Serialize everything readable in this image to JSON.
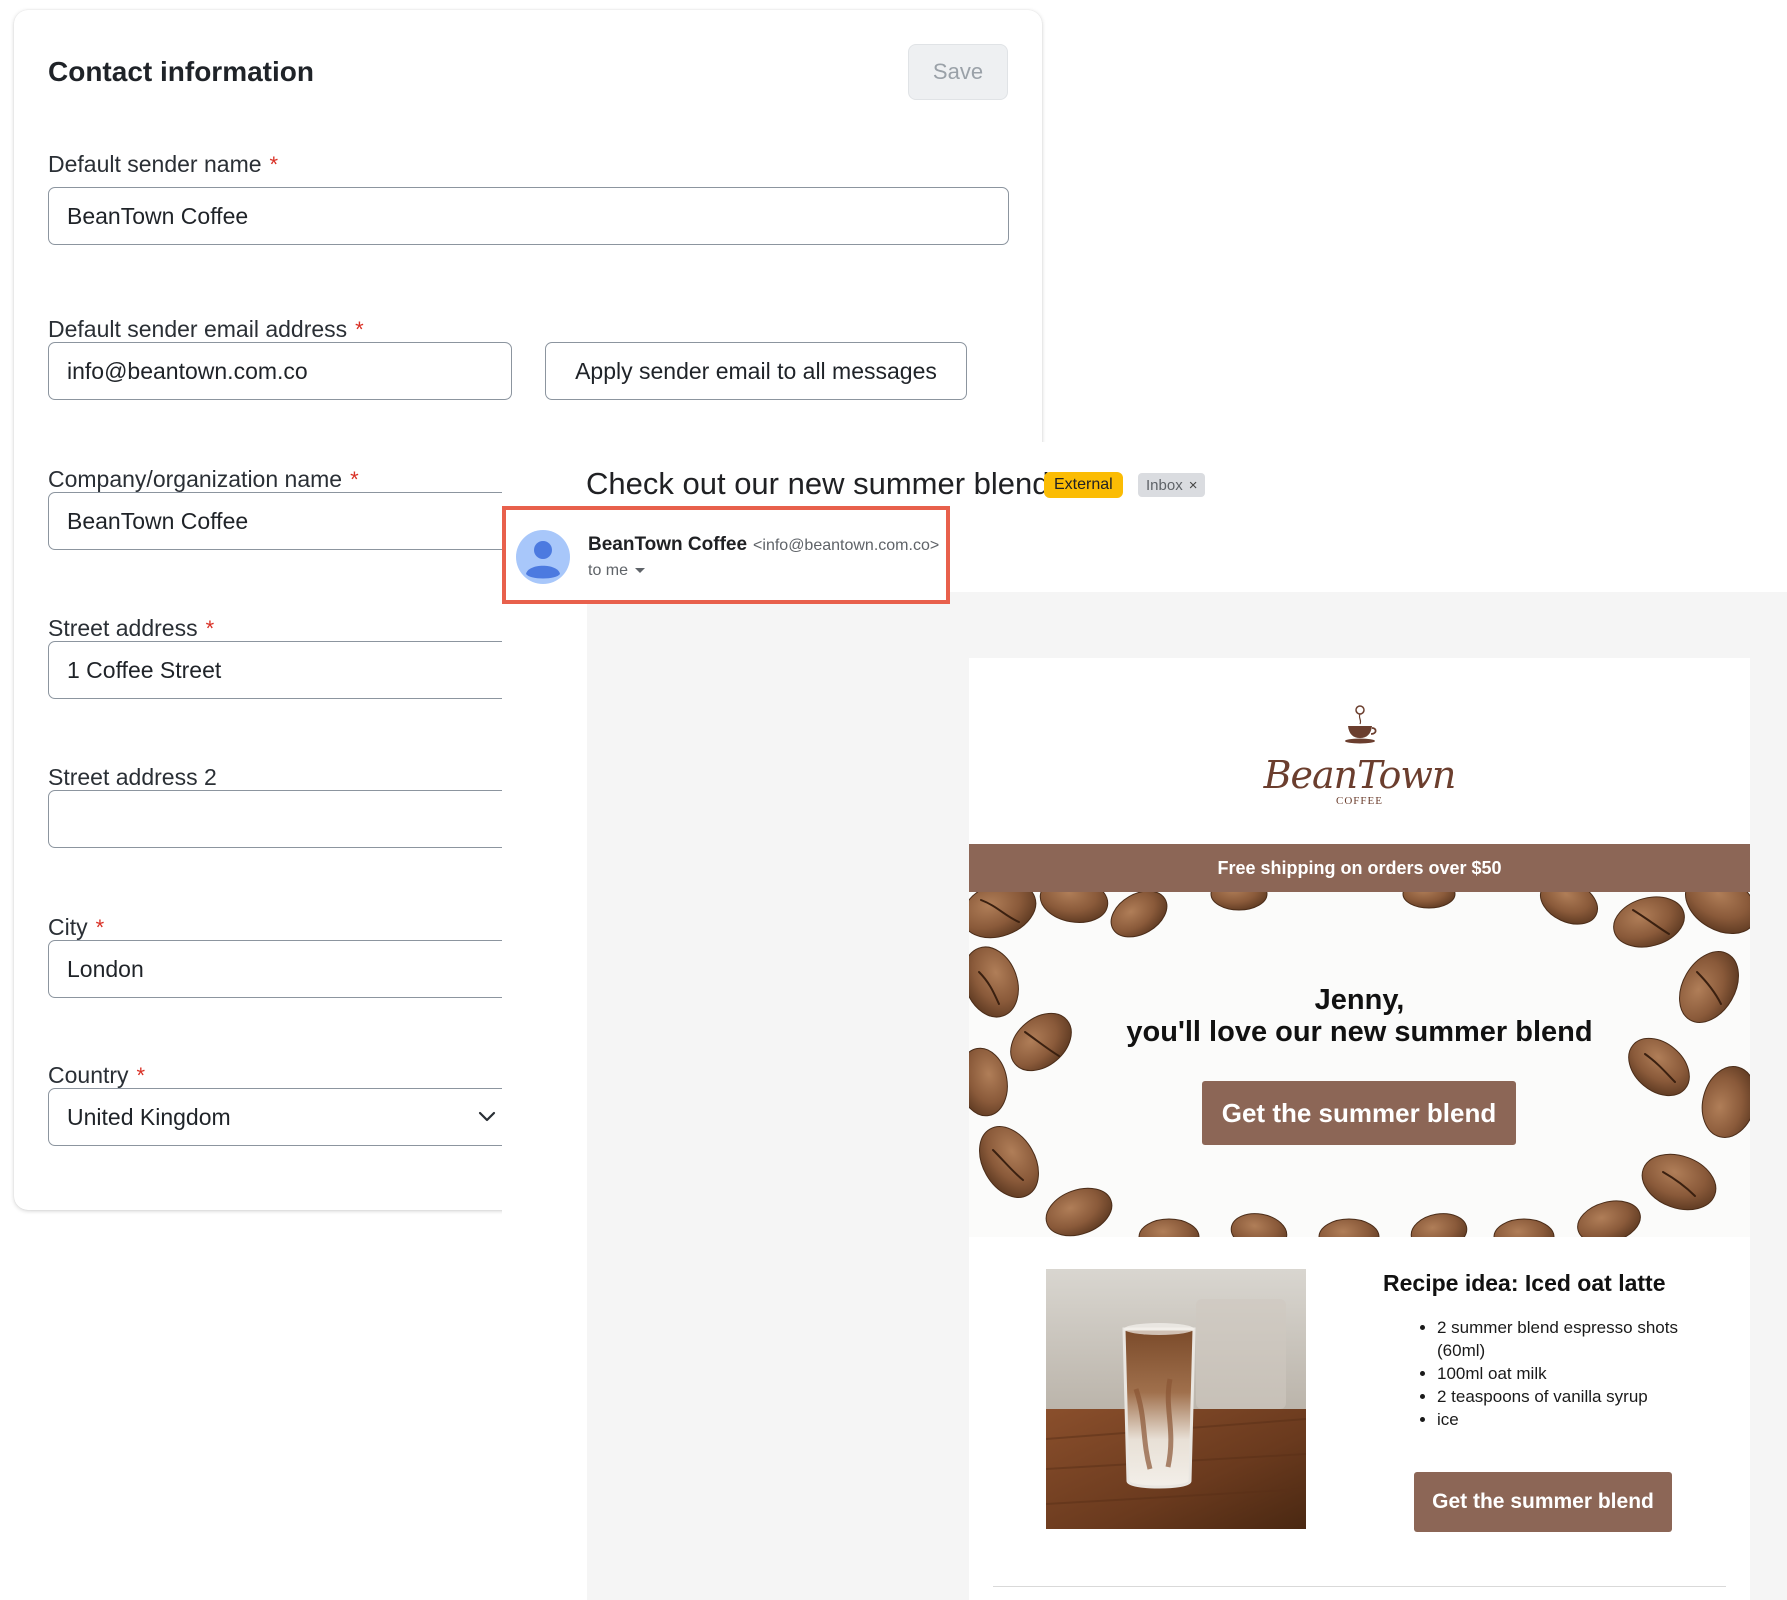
{
  "contact_form": {
    "title": "Contact information",
    "save_label": "Save",
    "required_marker": "*",
    "fields": {
      "sender_name": {
        "label": "Default sender name",
        "value": "BeanTown Coffee"
      },
      "sender_email": {
        "label": "Default sender email address",
        "value": "info@beantown.com.co"
      },
      "company": {
        "label": "Company/organization name",
        "value": "BeanTown Coffee"
      },
      "street": {
        "label": "Street address",
        "value": "1 Coffee Street"
      },
      "street2": {
        "label": "Street address 2",
        "value": ""
      },
      "city": {
        "label": "City",
        "value": "London"
      },
      "country": {
        "label": "Country",
        "value": "United Kingdom"
      }
    },
    "apply_label": "Apply sender email to all messages"
  },
  "email": {
    "subject": "Check out our new summer blend!",
    "tag_external": "External",
    "tag_inbox": "Inbox",
    "tag_inbox_close": "×",
    "sender_name": "BeanTown Coffee",
    "sender_email": "<info@beantown.com.co>",
    "to_me": "to me",
    "body": {
      "logo_main": "BeanTown",
      "logo_sub": "COFFEE",
      "promo": "Free shipping on orders over $50",
      "greeting": "Jenny,",
      "headline": "you'll love our new summer blend",
      "cta_label": "Get the summer blend",
      "recipe_title": "Recipe idea: Iced oat latte",
      "recipe_items": [
        "2 summer blend espresso shots (60ml)",
        "100ml oat milk",
        "2 teaspoons of vanilla syrup",
        "ice"
      ],
      "recipe_cta_label": "Get the summer blend"
    }
  },
  "colors": {
    "brand_brown": "#8c6656",
    "required_red": "#d93025",
    "highlight_border": "#e8604c",
    "external_tag": "#fbbc04"
  }
}
